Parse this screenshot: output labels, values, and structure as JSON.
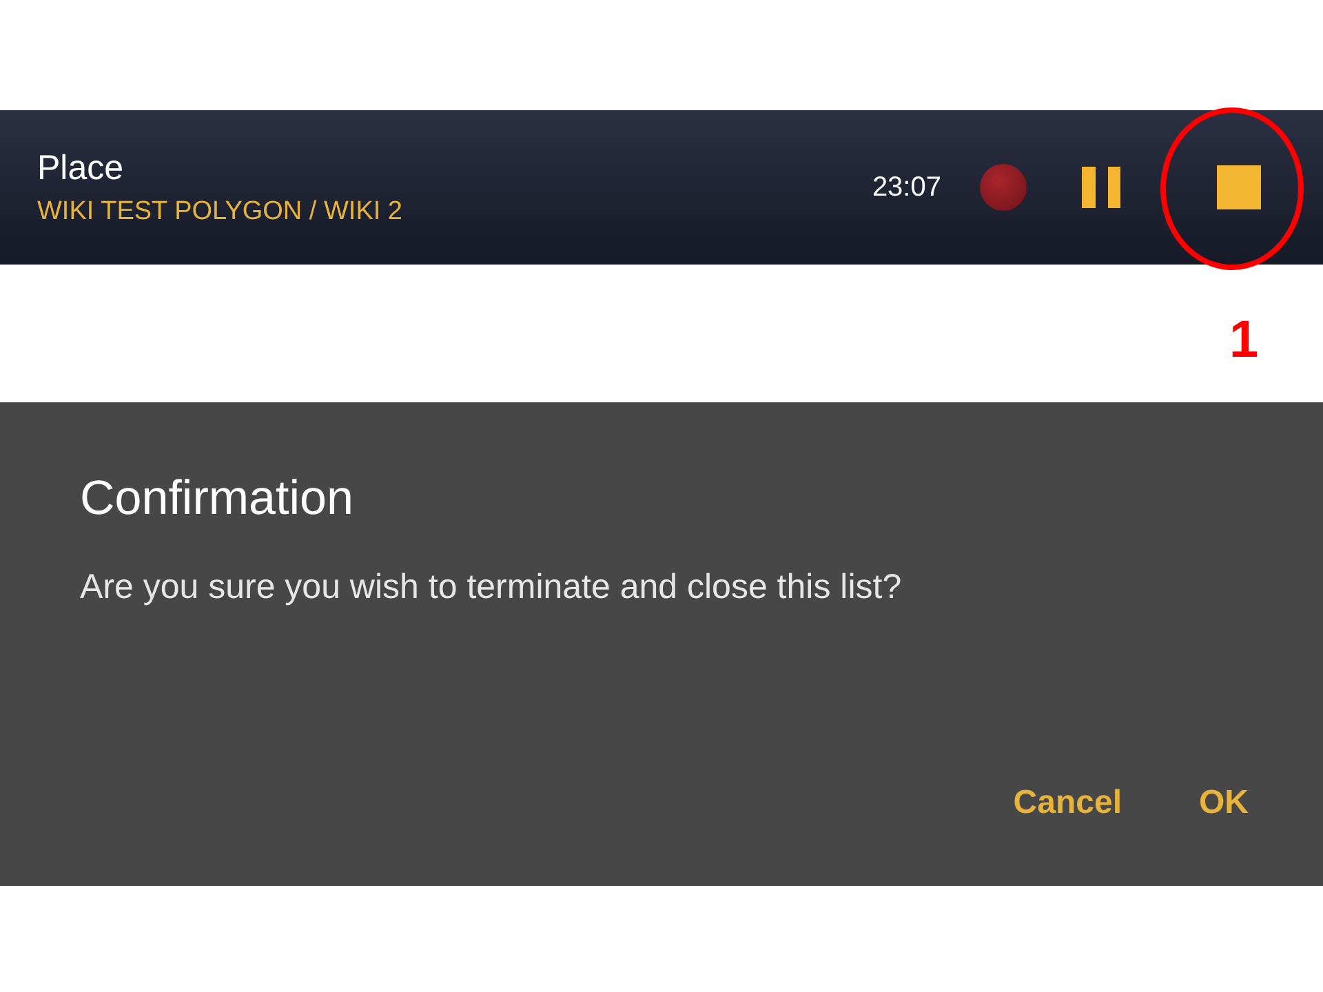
{
  "toolbar": {
    "title": "Place",
    "subtitle": "WIKI TEST POLYGON / WIKI 2",
    "time": "23:07"
  },
  "annotation": {
    "label": "1"
  },
  "dialog": {
    "title": "Confirmation",
    "message": "Are you sure you wish to terminate and close this list?",
    "buttons": [
      "Cancel",
      "OK"
    ]
  }
}
